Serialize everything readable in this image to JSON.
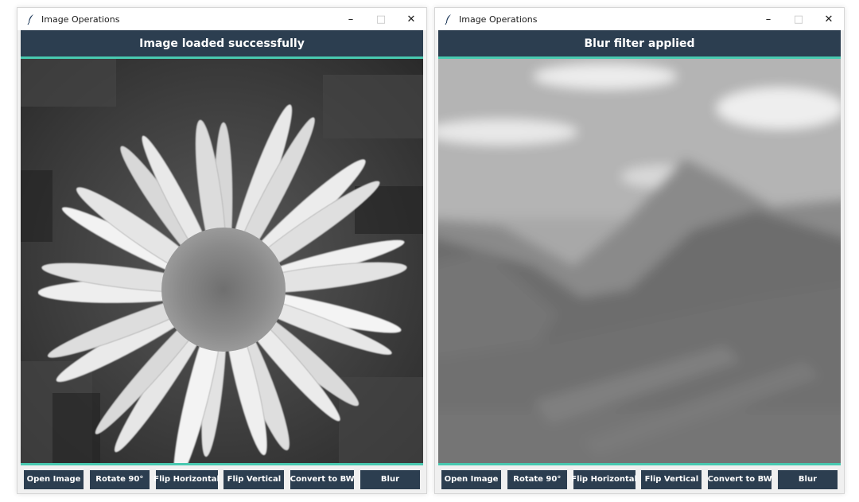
{
  "windows": [
    {
      "title": "Image Operations",
      "status": "Image loaded successfully",
      "image": "daisy-flower-grayscale",
      "buttons": [
        "Open Image",
        "Rotate 90°",
        "Flip Horizontal",
        "Flip Vertical",
        "Convert to BW",
        "Blur"
      ]
    },
    {
      "title": "Image Operations",
      "status": "Blur filter applied",
      "image": "mountain-landscape-blurred-grayscale",
      "buttons": [
        "Open Image",
        "Rotate 90°",
        "Flip Horizontal",
        "Flip Vertical",
        "Convert to BW",
        "Blur"
      ]
    }
  ],
  "window_controls": {
    "minimize": "–",
    "maximize": "□",
    "close": "✕"
  },
  "colors": {
    "header_bg": "#2c3e50",
    "accent": "#48c9b0",
    "button_bg": "#2c3e50",
    "button_text": "#ffffff"
  }
}
